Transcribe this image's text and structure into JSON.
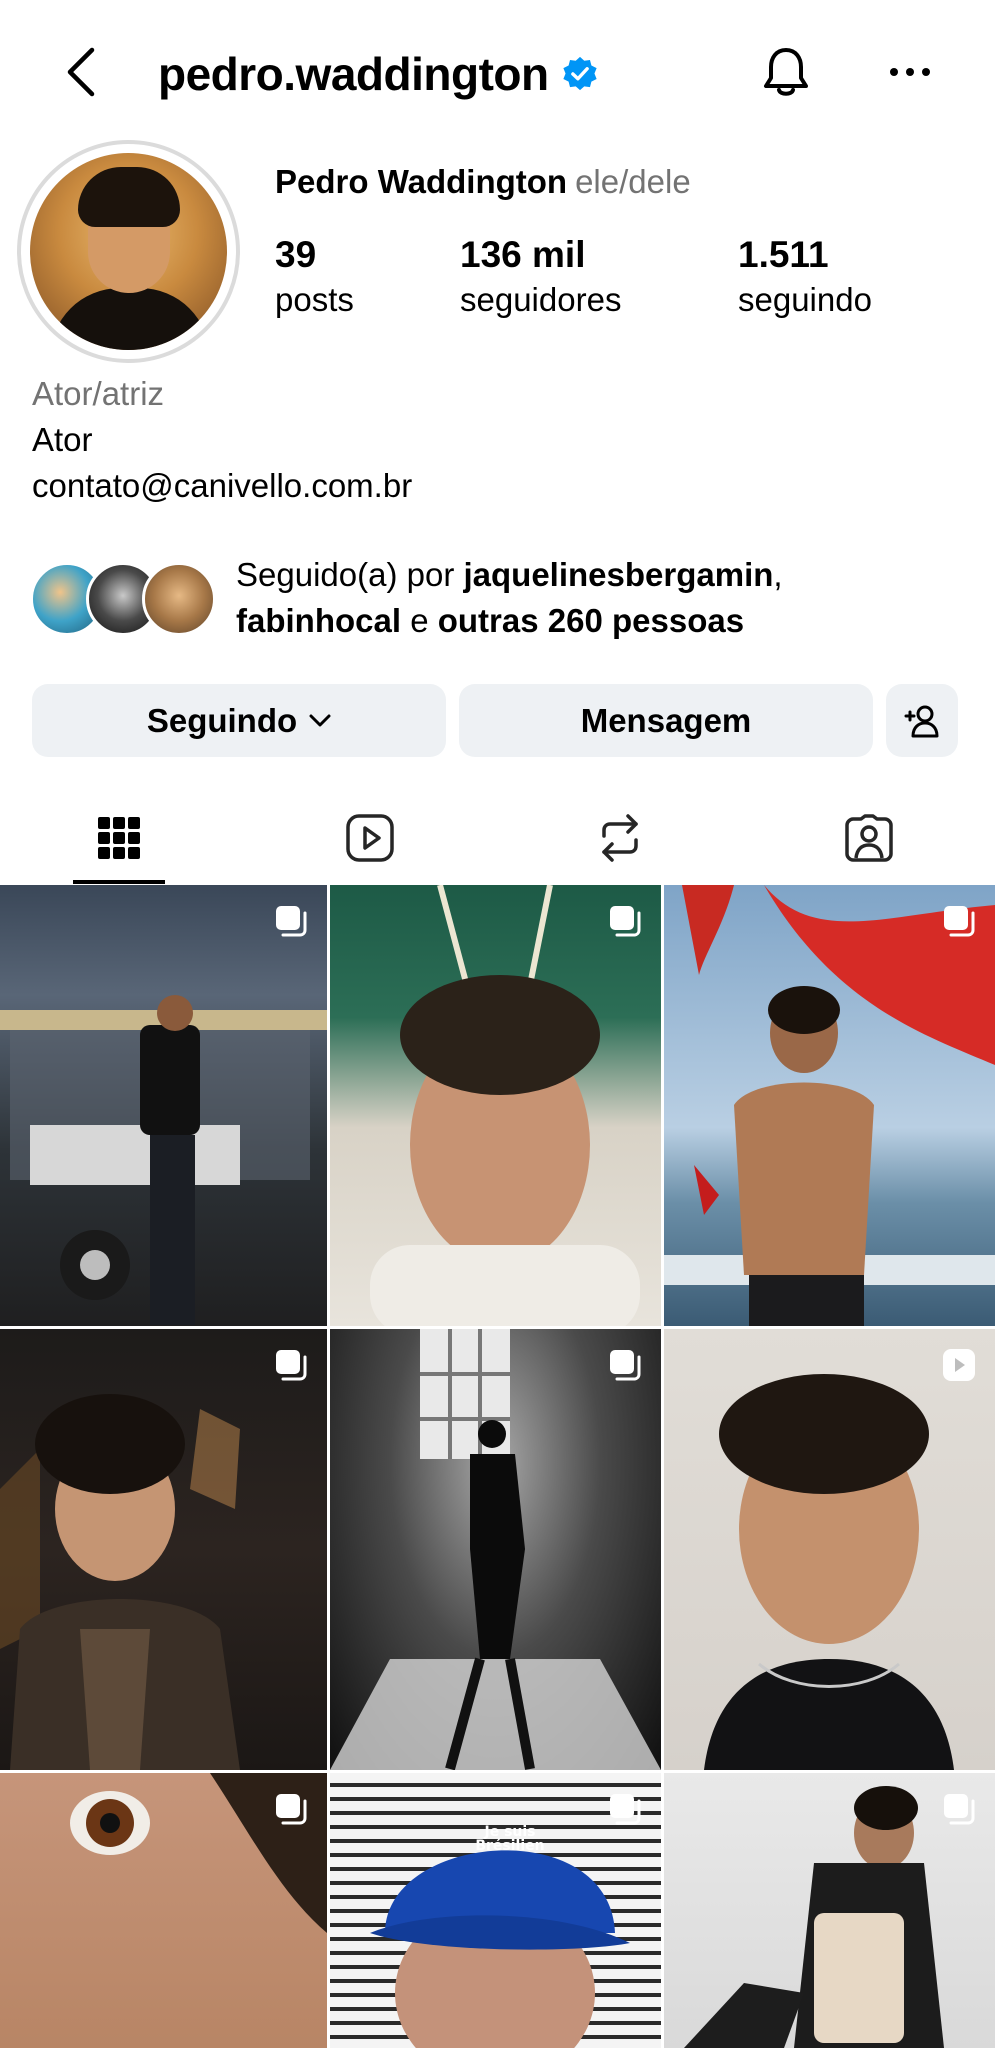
{
  "header": {
    "username": "pedro.waddington",
    "verified": true
  },
  "profile": {
    "display_name": "Pedro Waddington",
    "pronouns": "ele/dele",
    "stats": [
      {
        "value": "39",
        "label": "posts"
      },
      {
        "value": "136 mil",
        "label": "seguidores"
      },
      {
        "value": "1.511",
        "label": "seguindo"
      }
    ],
    "category": "Ator/atriz",
    "bio": "Ator",
    "contact": "contato@canivello.com.br"
  },
  "followed_by": {
    "prefix": "Seguido(a) por ",
    "user1": "jaquelinesbergamin",
    "separator": ",",
    "user2": "fabinhocal",
    "conjunction": " e ",
    "others": "outras 260 pessoas"
  },
  "buttons": {
    "following": "Seguindo",
    "message": "Mensagem"
  },
  "tabs": [
    "grid-icon",
    "reels-icon",
    "reposts-icon",
    "tagged-icon"
  ],
  "colors": {
    "verified": "#0095f6",
    "button_bg": "#eef1f4",
    "secondary_text": "#737373"
  },
  "posts": [
    {
      "badge": "multiple"
    },
    {
      "badge": "multiple"
    },
    {
      "badge": "multiple"
    },
    {
      "badge": "multiple"
    },
    {
      "badge": "multiple"
    },
    {
      "badge": "reel"
    },
    {
      "badge": "multiple"
    },
    {
      "badge": "multiple"
    },
    {
      "badge": "multiple"
    }
  ],
  "post_caption_cap": "Je suis Brésilien"
}
